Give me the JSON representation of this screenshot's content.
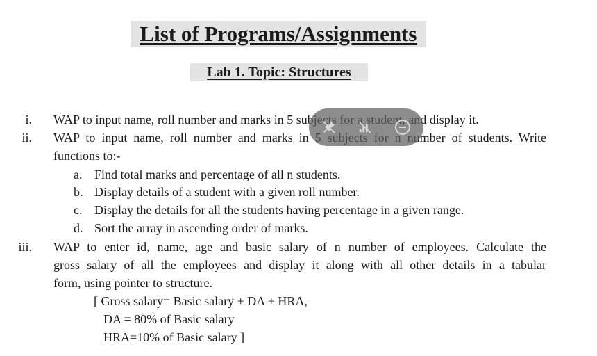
{
  "doc": {
    "title": "List of Programs/Assignments",
    "subtitle": "Lab 1.   Topic: Structures",
    "items": [
      {
        "numeral": "i.",
        "lines": [
          "WAP to input name, roll number and marks in 5 subjects for a student, and display it."
        ]
      },
      {
        "numeral": "ii.",
        "lines": [
          "WAP to input name, roll number and marks in 5 subjects for n number of students. Write",
          "functions to:-"
        ],
        "subitems": [
          {
            "letter": "a.",
            "text": "Find total marks and percentage of all n students."
          },
          {
            "letter": "b.",
            "text": "Display details of a student with a given roll number."
          },
          {
            "letter": "c.",
            "text": "Display the details for all the students having percentage in a given range."
          },
          {
            "letter": "d.",
            "text": "Sort the array in ascending order of marks."
          }
        ]
      },
      {
        "numeral": "iii.",
        "lines": [
          "WAP to enter id, name, age and basic salary of n number of employees. Calculate the",
          "gross salary of all the employees and display it along with all other details in a tabular",
          "form, using pointer to structure."
        ],
        "formula": [
          "[ Gross salary= Basic salary + DA + HRA,",
          "DA = 80% of Basic salary",
          "HRA=10% of Basic salary ]"
        ]
      }
    ]
  },
  "overlay": {
    "icons": [
      "pin-icon",
      "signal-off-icon",
      "close-circle-icon"
    ],
    "colors": {
      "background": "#5f5f5f",
      "icon": "#d8d8d8"
    }
  }
}
